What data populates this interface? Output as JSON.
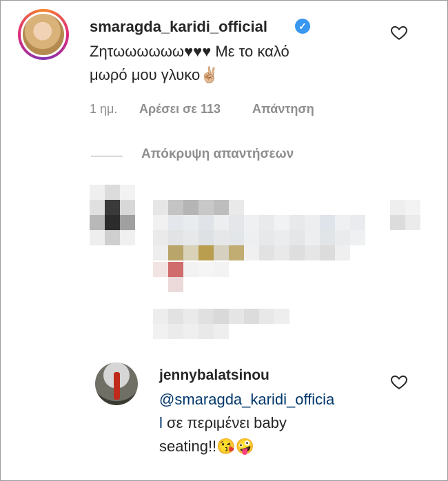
{
  "comment": {
    "username": "smaragda_karidi_official",
    "text_line1": "Ζητωωωωωω♥♥♥ Με το καλό",
    "text_line2": "μωρό μου γλυκο✌🏼",
    "time": "1 ημ.",
    "likes": "Αρέσει σε 113",
    "reply": "Απάντηση",
    "hide_replies": "Απόκρυψη απαντήσεων"
  },
  "reply_comment": {
    "username": "jennybalatsinou",
    "mention_line1": "@smaragda_karidi_officia",
    "mention_line2": "l",
    "text_line2": " σε περιμένει baby",
    "text_line3": "seating!!😘🤪"
  },
  "colors": {
    "text": "#262626",
    "secondary": "#8e8e8e",
    "link": "#00376b",
    "verified": "#3897f0"
  },
  "icons": [
    "heart-outline-icon",
    "verified-badge-icon"
  ]
}
